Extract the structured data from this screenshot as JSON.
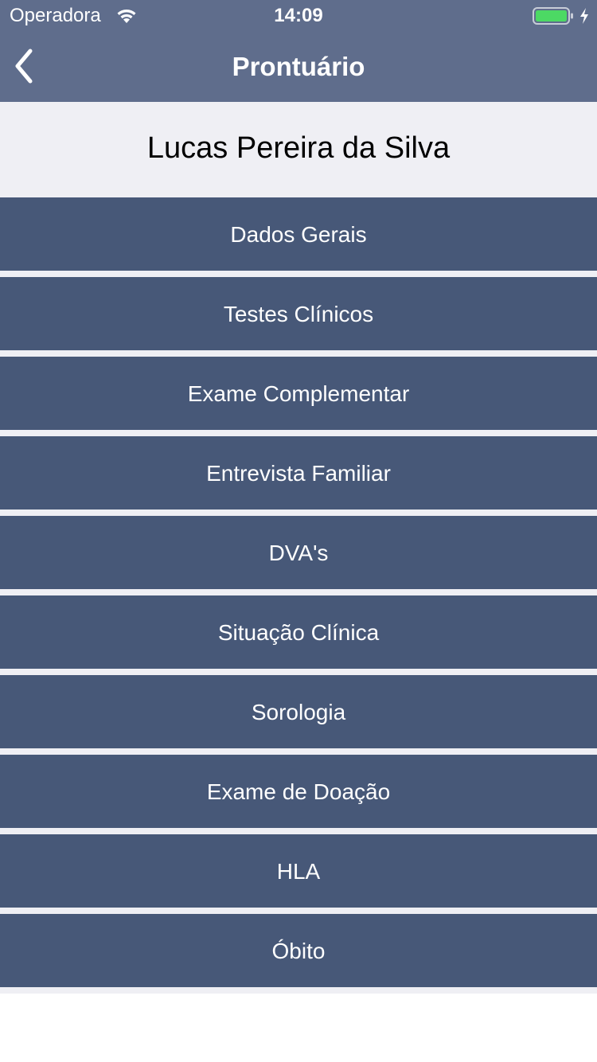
{
  "status_bar": {
    "carrier": "Operadora",
    "time": "14:09",
    "battery_color": "#4cd964"
  },
  "nav": {
    "title": "Prontuário",
    "back_icon": "chevron-left-icon"
  },
  "patient": {
    "name": "Lucas Pereira da Silva"
  },
  "colors": {
    "nav_background": "#5f6d8c",
    "menu_item_background": "#475878",
    "header_background": "#efeff4"
  },
  "menu": {
    "items": [
      {
        "label": "Dados Gerais"
      },
      {
        "label": "Testes Clínicos"
      },
      {
        "label": "Exame Complementar"
      },
      {
        "label": "Entrevista Familiar"
      },
      {
        "label": "DVA's"
      },
      {
        "label": "Situação Clínica"
      },
      {
        "label": "Sorologia"
      },
      {
        "label": "Exame de Doação"
      },
      {
        "label": "HLA"
      },
      {
        "label": "Óbito"
      }
    ]
  }
}
